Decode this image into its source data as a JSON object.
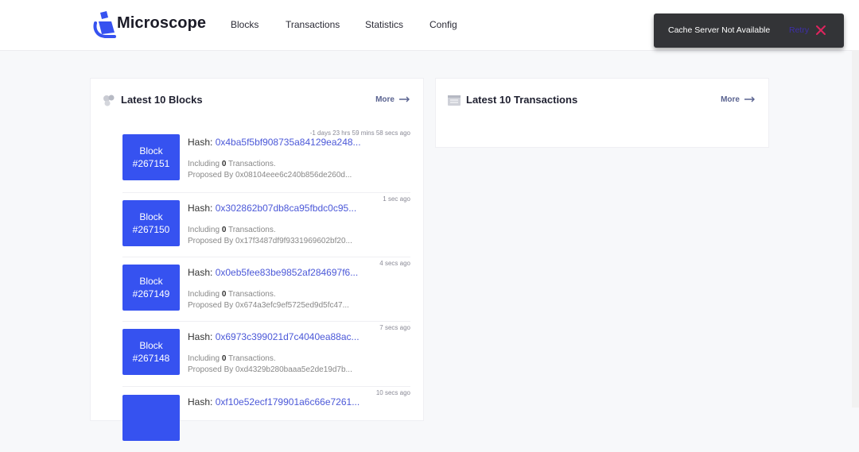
{
  "brand": "Microscope",
  "nav": [
    "Blocks",
    "Transactions",
    "Statistics",
    "Config"
  ],
  "toast": {
    "message": "Cache Server Not Available",
    "action": "Retry"
  },
  "blocks_panel": {
    "title": "Latest 10 Blocks",
    "more": "More"
  },
  "tx_panel": {
    "title": "Latest 10 Transactions",
    "more": "More"
  },
  "labels": {
    "block": "Block",
    "hash": "Hash:",
    "including": "Including",
    "transactions": "Transactions.",
    "proposed_by": "Proposed By"
  },
  "blocks": [
    {
      "number": "#267151",
      "time": "-1 days 23 hrs 59 mins 58 secs ago",
      "hash": "0x4ba5f5bf908735a84129ea248...",
      "tx_count": "0",
      "proposer": "0x08104eee6c240b856de260d..."
    },
    {
      "number": "#267150",
      "time": "1 sec ago",
      "hash": "0x302862b07db8ca95fbdc0c95...",
      "tx_count": "0",
      "proposer": "0x17f3487df9f9331969602bf20..."
    },
    {
      "number": "#267149",
      "time": "4 secs ago",
      "hash": "0x0eb5fee83be9852af284697f6...",
      "tx_count": "0",
      "proposer": "0x674a3efc9ef5725ed9d5fc47..."
    },
    {
      "number": "#267148",
      "time": "7 secs ago",
      "hash": "0x6973c399021d7c4040ea88ac...",
      "tx_count": "0",
      "proposer": "0xd4329b280baaa5e2de19d7b..."
    },
    {
      "number": "",
      "time": "10 secs ago",
      "hash": "0xf10e52ecf179901a6c66e7261...",
      "tx_count": "",
      "proposer": ""
    }
  ],
  "colors": {
    "accent": "#3652f0",
    "link": "#4b58d8",
    "toast_bg": "#333437",
    "close": "#e0245e"
  }
}
